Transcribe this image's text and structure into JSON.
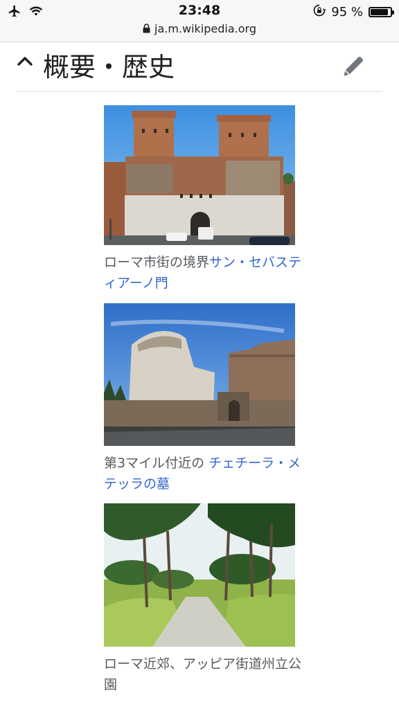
{
  "status_bar": {
    "time": "23:48",
    "battery": "95 %",
    "battery_level": 0.95,
    "icons": [
      "airplane-icon",
      "wifi-icon",
      "orientation-lock-icon",
      "battery-icon"
    ]
  },
  "browser": {
    "url": "ja.m.wikipedia.org"
  },
  "section": {
    "title": "概要・歴史",
    "collapse_icon": "chevron-up-icon",
    "edit_icon": "pencil-icon"
  },
  "figures": [
    {
      "caption_text": "ローマ市街の境界",
      "caption_link": "サン・セバスティアーノ門"
    },
    {
      "caption_text": "第3マイル付近の ",
      "caption_link": "チェチーラ・メテッラの墓"
    },
    {
      "caption_text": "ローマ近郊、アッピア街道州立公園",
      "caption_link": ""
    }
  ],
  "colors": {
    "link": "#3366cc",
    "caption": "#54595d",
    "divider": "#e2e2e2"
  }
}
